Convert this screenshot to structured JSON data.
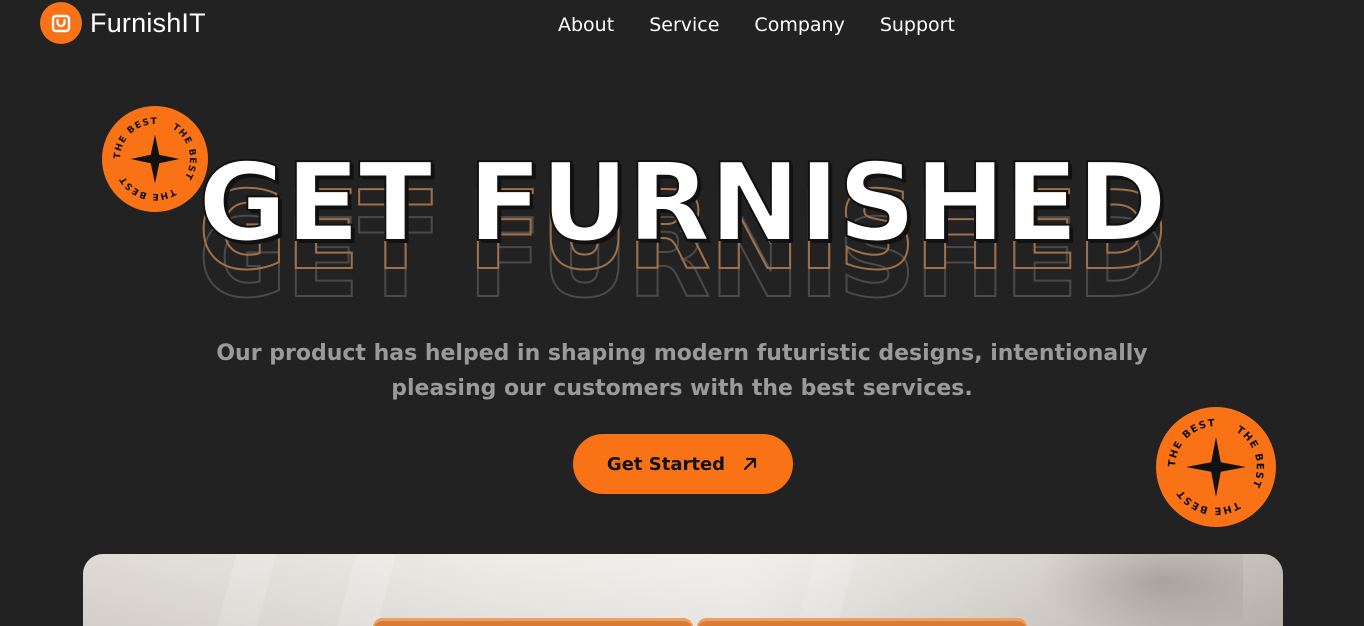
{
  "brand": {
    "name": "FurnishIT",
    "logo_icon": "shopping-bag-icon",
    "accent": "#f97316"
  },
  "nav": {
    "items": [
      "About",
      "Service",
      "Company",
      "Support"
    ]
  },
  "hero": {
    "title": "GET FURNISHED",
    "subtitle_line1": "Our product has helped in shaping modern futuristic designs, intentionally",
    "subtitle_line2": "pleasing our customers with the best services.",
    "cta_label": "Get Started",
    "cta_icon": "arrow-up-right-icon"
  },
  "badges": {
    "text": "THE BEST",
    "icon": "four-point-star-icon"
  },
  "colors": {
    "background": "#222222",
    "accent": "#f97316",
    "subtitle": "#9a9a9a"
  }
}
